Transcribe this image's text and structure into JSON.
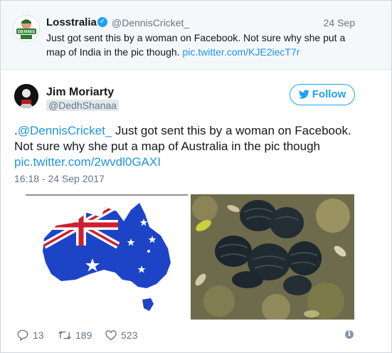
{
  "quoted": {
    "name": "Losstralia",
    "handle": "@DennisCricket_",
    "date": "24 Sep",
    "text": "Just got sent this by a woman on Facebook. Not sure why she put a map of India in the pic though.",
    "link": "pic.twitter.com/KJE2iecT7r",
    "avatar_label": "DENNIS"
  },
  "tweet": {
    "name": "Jim Moriarty",
    "handle": "@DedhShanaa",
    "follow_label": "Follow",
    "prefix": ".",
    "mention": "@DennisCricket_",
    "text": " Just got sent this by a woman on Facebook. Not sure why she put a map of Australia in the pic though",
    "link": "pic.twitter.com/2wvdl0GAXI",
    "timestamp": "16:18 - 24 Sep 2017"
  },
  "actions": {
    "replies": "13",
    "retweets": "189",
    "likes": "523"
  },
  "colors": {
    "accent": "#1da1f2",
    "link": "#1b95e0",
    "map_blue": "#1d44c7",
    "flag_red": "#cc1f2f"
  },
  "icons": [
    "verified-icon",
    "twitter-bird-icon",
    "reply-icon",
    "retweet-icon",
    "like-icon",
    "info-icon"
  ]
}
